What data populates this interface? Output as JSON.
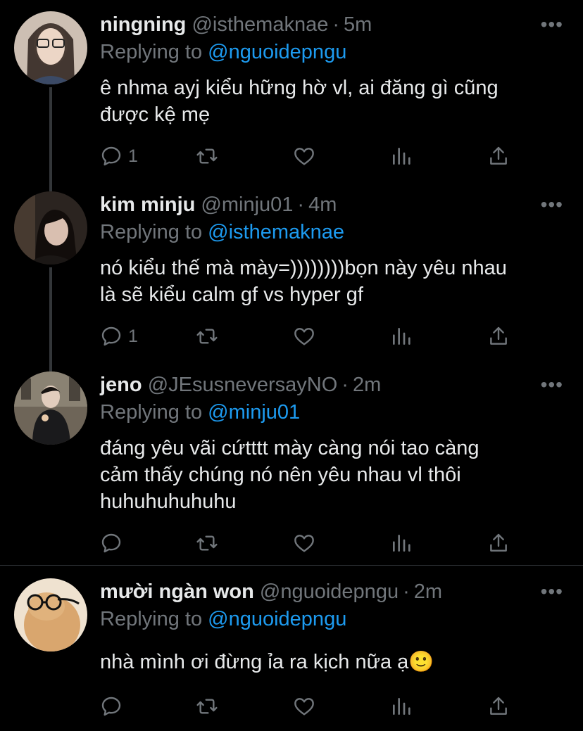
{
  "tweets": [
    {
      "name": "ningning",
      "handle": "@isthemaknae",
      "time": "5m",
      "replying_label": "Replying to",
      "replying_to": "@nguoidepngu",
      "text_lines": [
        "ê nhma ayj kiểu hững hờ vl, ai đăng gì cũng",
        "được kệ mẹ"
      ],
      "reply_count": "1",
      "avatar_color": "#b9a79a"
    },
    {
      "name": "kim minju",
      "handle": "@minju01",
      "time": "4m",
      "replying_label": "Replying to",
      "replying_to": "@isthemaknae",
      "text_lines": [
        "nó kiểu thế mà mày=))))))))bọn này yêu nhau",
        "là sẽ kiểu calm gf vs hyper gf"
      ],
      "reply_count": "1",
      "avatar_color": "#3a2a25"
    },
    {
      "name": "jeno",
      "handle": "@JEsusneversayNO",
      "time": "2m",
      "replying_label": "Replying to",
      "replying_to": "@minju01",
      "text_lines": [
        "đáng yêu vãi cứtttt mày càng nói tao càng",
        "cảm thấy chúng nó nên yêu nhau vl thôi",
        "huhuhuhuhuhu"
      ],
      "reply_count": "",
      "avatar_color": "#5a5550"
    },
    {
      "name": "mười ngàn won",
      "handle": "@nguoidepngu",
      "time": "2m",
      "replying_label": "Replying to",
      "replying_to": "@nguoidepngu",
      "text_lines": [
        "nhà mình ơi đừng ỉa ra kịch nữa ạ🙂"
      ],
      "reply_count": "",
      "avatar_color": "#c9a27a"
    }
  ],
  "colors": {
    "accent": "#1d9bf0",
    "muted": "#71767b",
    "text": "#e7e9ea",
    "background": "#000000"
  },
  "icons": [
    "reply-icon",
    "retweet-icon",
    "like-icon",
    "views-icon",
    "share-icon",
    "more-icon"
  ]
}
